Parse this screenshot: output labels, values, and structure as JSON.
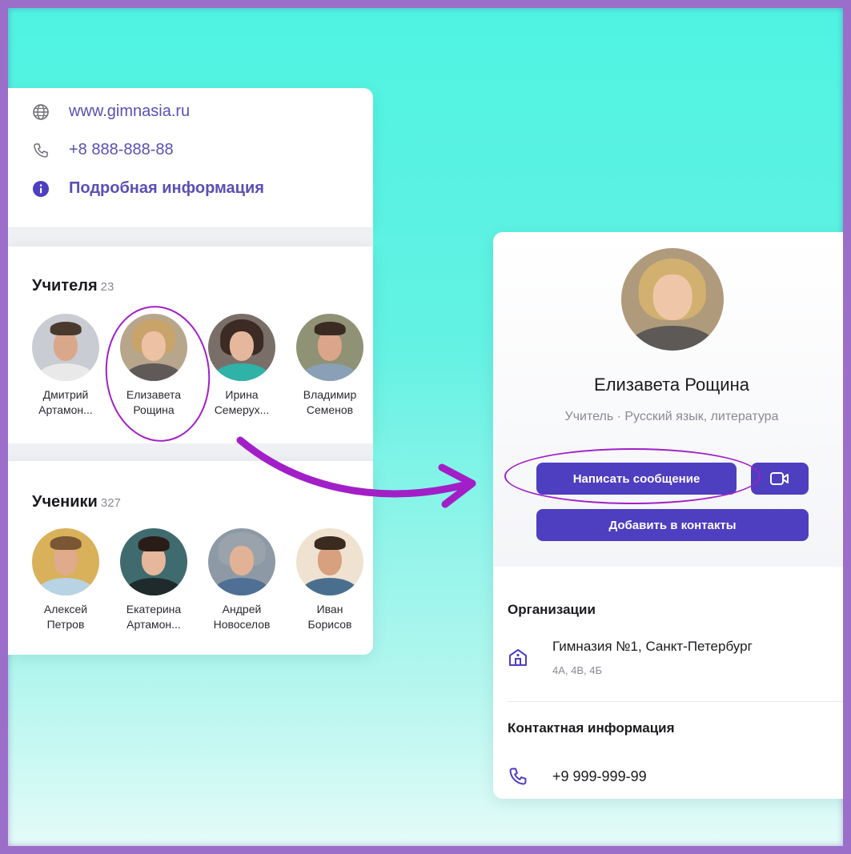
{
  "contacts": {
    "website": "www.gimnasia.ru",
    "phone": "+8 888-888-88",
    "details_link": "Подробная информация"
  },
  "teachers": {
    "title": "Учителя",
    "count": "23",
    "people": [
      {
        "line1": "Дмитрий",
        "line2": "Артамон..."
      },
      {
        "line1": "Елизавета",
        "line2": "Рощина"
      },
      {
        "line1": "Ирина",
        "line2": "Семерух..."
      },
      {
        "line1": "Владимир",
        "line2": "Семенов"
      }
    ]
  },
  "students": {
    "title": "Ученики",
    "count": "327",
    "people": [
      {
        "line1": "Алексей",
        "line2": "Петров"
      },
      {
        "line1": "Екатерина",
        "line2": "Артамон..."
      },
      {
        "line1": "Андрей",
        "line2": "Новоселов"
      },
      {
        "line1": "Иван",
        "line2": "Борисов"
      }
    ]
  },
  "profile": {
    "name": "Елизавета Рощина",
    "subtitle": "Учитель · Русский язык, литература",
    "message_button": "Написать сообщение",
    "add_contact_button": "Добавить в контакты",
    "organizations_title": "Организации",
    "org_name": "Гимназия №1, Санкт-Петербург",
    "org_classes": "4А, 4В, 4Б",
    "contact_info_title": "Контактная информация",
    "phone": "+9 999-999-99"
  },
  "colors": {
    "accent": "#4e3ec0",
    "link": "#5a4fb5",
    "annotation": "#a21fc7",
    "background_top": "#4ff3e2"
  },
  "icons": [
    "globe-icon",
    "phone-icon",
    "info-icon",
    "video-camera-icon",
    "school-building-icon"
  ]
}
